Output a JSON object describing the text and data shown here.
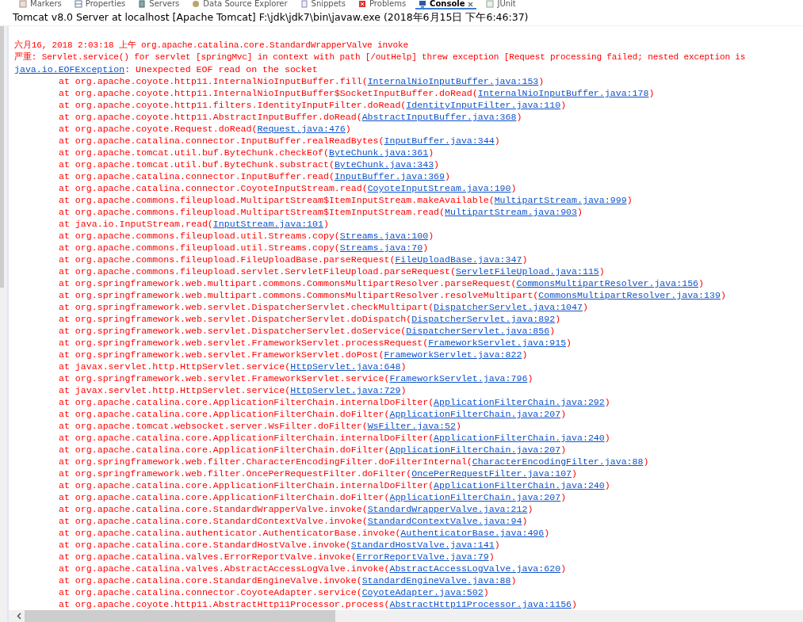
{
  "tabs": [
    {
      "label": "Markers",
      "kind": "markers",
      "selected": false
    },
    {
      "label": "Properties",
      "kind": "properties",
      "selected": false
    },
    {
      "label": "Servers",
      "kind": "servers",
      "selected": false
    },
    {
      "label": "Data Source Explorer",
      "kind": "database",
      "selected": false
    },
    {
      "label": "Snippets",
      "kind": "snippets",
      "selected": false
    },
    {
      "label": "Problems",
      "kind": "problems",
      "selected": false
    },
    {
      "label": "Console",
      "kind": "console",
      "selected": true,
      "closable": true
    },
    {
      "label": "JUnit",
      "kind": "junit",
      "selected": false
    }
  ],
  "console": {
    "title": "Tomcat v8.0 Server at localhost [Apache Tomcat] F:\\jdk\\jdk7\\bin\\javaw.exe (2018年6月15日 下午6:46:37)",
    "messages": [
      {
        "kind": "text",
        "text": "六月16, 2018 2:03:18 上午 org.apache.catalina.core.StandardWrapperValve invoke"
      },
      {
        "kind": "text",
        "text": "严重: Servlet.service() for servlet [springMvc] in context with path [/outHelp] threw exception [Request processing failed; nested exception is"
      },
      {
        "kind": "exception",
        "link": "java.io.EOFException",
        "text": ": Unexpected EOF read on the socket"
      }
    ],
    "frames": [
      {
        "call": "at org.apache.coyote.http11.InternalNioInputBuffer.fill(",
        "source": "InternalNioInputBuffer.java:153",
        "close": ")"
      },
      {
        "call": "at org.apache.coyote.http11.InternalNioInputBuffer$SocketInputBuffer.doRead(",
        "source": "InternalNioInputBuffer.java:178",
        "close": ")"
      },
      {
        "call": "at org.apache.coyote.http11.filters.IdentityInputFilter.doRead(",
        "source": "IdentityInputFilter.java:110",
        "close": ")"
      },
      {
        "call": "at org.apache.coyote.http11.AbstractInputBuffer.doRead(",
        "source": "AbstractInputBuffer.java:368",
        "close": ")"
      },
      {
        "call": "at org.apache.coyote.Request.doRead(",
        "source": "Request.java:476",
        "close": ")"
      },
      {
        "call": "at org.apache.catalina.connector.InputBuffer.realReadBytes(",
        "source": "InputBuffer.java:344",
        "close": ")"
      },
      {
        "call": "at org.apache.tomcat.util.buf.ByteChunk.checkEof(",
        "source": "ByteChunk.java:361",
        "close": ")"
      },
      {
        "call": "at org.apache.tomcat.util.buf.ByteChunk.substract(",
        "source": "ByteChunk.java:343",
        "close": ")"
      },
      {
        "call": "at org.apache.catalina.connector.InputBuffer.read(",
        "source": "InputBuffer.java:369",
        "close": ")"
      },
      {
        "call": "at org.apache.catalina.connector.CoyoteInputStream.read(",
        "source": "CoyoteInputStream.java:190",
        "close": ")"
      },
      {
        "call": "at org.apache.commons.fileupload.MultipartStream$ItemInputStream.makeAvailable(",
        "source": "MultipartStream.java:999",
        "close": ")"
      },
      {
        "call": "at org.apache.commons.fileupload.MultipartStream$ItemInputStream.read(",
        "source": "MultipartStream.java:903",
        "close": ")"
      },
      {
        "call": "at java.io.InputStream.read(",
        "source": "InputStream.java:101",
        "close": ")"
      },
      {
        "call": "at org.apache.commons.fileupload.util.Streams.copy(",
        "source": "Streams.java:100",
        "close": ")"
      },
      {
        "call": "at org.apache.commons.fileupload.util.Streams.copy(",
        "source": "Streams.java:70",
        "close": ")"
      },
      {
        "call": "at org.apache.commons.fileupload.FileUploadBase.parseRequest(",
        "source": "FileUploadBase.java:347",
        "close": ")"
      },
      {
        "call": "at org.apache.commons.fileupload.servlet.ServletFileUpload.parseRequest(",
        "source": "ServletFileUpload.java:115",
        "close": ")"
      },
      {
        "call": "at org.springframework.web.multipart.commons.CommonsMultipartResolver.parseRequest(",
        "source": "CommonsMultipartResolver.java:156",
        "close": ")"
      },
      {
        "call": "at org.springframework.web.multipart.commons.CommonsMultipartResolver.resolveMultipart(",
        "source": "CommonsMultipartResolver.java:139",
        "close": ")"
      },
      {
        "call": "at org.springframework.web.servlet.DispatcherServlet.checkMultipart(",
        "source": "DispatcherServlet.java:1047",
        "close": ")"
      },
      {
        "call": "at org.springframework.web.servlet.DispatcherServlet.doDispatch(",
        "source": "DispatcherServlet.java:892",
        "close": ")"
      },
      {
        "call": "at org.springframework.web.servlet.DispatcherServlet.doService(",
        "source": "DispatcherServlet.java:856",
        "close": ")"
      },
      {
        "call": "at org.springframework.web.servlet.FrameworkServlet.processRequest(",
        "source": "FrameworkServlet.java:915",
        "close": ")"
      },
      {
        "call": "at org.springframework.web.servlet.FrameworkServlet.doPost(",
        "source": "FrameworkServlet.java:822",
        "close": ")"
      },
      {
        "call": "at javax.servlet.http.HttpServlet.service(",
        "source": "HttpServlet.java:648",
        "close": ")"
      },
      {
        "call": "at org.springframework.web.servlet.FrameworkServlet.service(",
        "source": "FrameworkServlet.java:796",
        "close": ")"
      },
      {
        "call": "at javax.servlet.http.HttpServlet.service(",
        "source": "HttpServlet.java:729",
        "close": ")"
      },
      {
        "call": "at org.apache.catalina.core.ApplicationFilterChain.internalDoFilter(",
        "source": "ApplicationFilterChain.java:292",
        "close": ")"
      },
      {
        "call": "at org.apache.catalina.core.ApplicationFilterChain.doFilter(",
        "source": "ApplicationFilterChain.java:207",
        "close": ")"
      },
      {
        "call": "at org.apache.tomcat.websocket.server.WsFilter.doFilter(",
        "source": "WsFilter.java:52",
        "close": ")"
      },
      {
        "call": "at org.apache.catalina.core.ApplicationFilterChain.internalDoFilter(",
        "source": "ApplicationFilterChain.java:240",
        "close": ")"
      },
      {
        "call": "at org.apache.catalina.core.ApplicationFilterChain.doFilter(",
        "source": "ApplicationFilterChain.java:207",
        "close": ")"
      },
      {
        "call": "at org.springframework.web.filter.CharacterEncodingFilter.doFilterInternal(",
        "source": "CharacterEncodingFilter.java:88",
        "close": ")"
      },
      {
        "call": "at org.springframework.web.filter.OncePerRequestFilter.doFilter(",
        "source": "OncePerRequestFilter.java:107",
        "close": ")"
      },
      {
        "call": "at org.apache.catalina.core.ApplicationFilterChain.internalDoFilter(",
        "source": "ApplicationFilterChain.java:240",
        "close": ")"
      },
      {
        "call": "at org.apache.catalina.core.ApplicationFilterChain.doFilter(",
        "source": "ApplicationFilterChain.java:207",
        "close": ")"
      },
      {
        "call": "at org.apache.catalina.core.StandardWrapperValve.invoke(",
        "source": "StandardWrapperValve.java:212",
        "close": ")"
      },
      {
        "call": "at org.apache.catalina.core.StandardContextValve.invoke(",
        "source": "StandardContextValve.java:94",
        "close": ")"
      },
      {
        "call": "at org.apache.catalina.authenticator.AuthenticatorBase.invoke(",
        "source": "AuthenticatorBase.java:496",
        "close": ")"
      },
      {
        "call": "at org.apache.catalina.core.StandardHostValve.invoke(",
        "source": "StandardHostValve.java:141",
        "close": ")"
      },
      {
        "call": "at org.apache.catalina.valves.ErrorReportValve.invoke(",
        "source": "ErrorReportValve.java:79",
        "close": ")"
      },
      {
        "call": "at org.apache.catalina.valves.AbstractAccessLogValve.invoke(",
        "source": "AbstractAccessLogValve.java:620",
        "close": ")"
      },
      {
        "call": "at org.apache.catalina.core.StandardEngineValve.invoke(",
        "source": "StandardEngineValve.java:88",
        "close": ")"
      },
      {
        "call": "at org.apache.catalina.connector.CoyoteAdapter.service(",
        "source": "CoyoteAdapter.java:502",
        "close": ")"
      },
      {
        "call": "at org.apache.coyote.http11.AbstractHttp11Processor.process(",
        "source": "AbstractHttp11Processor.java:1156",
        "close": ")"
      }
    ]
  }
}
